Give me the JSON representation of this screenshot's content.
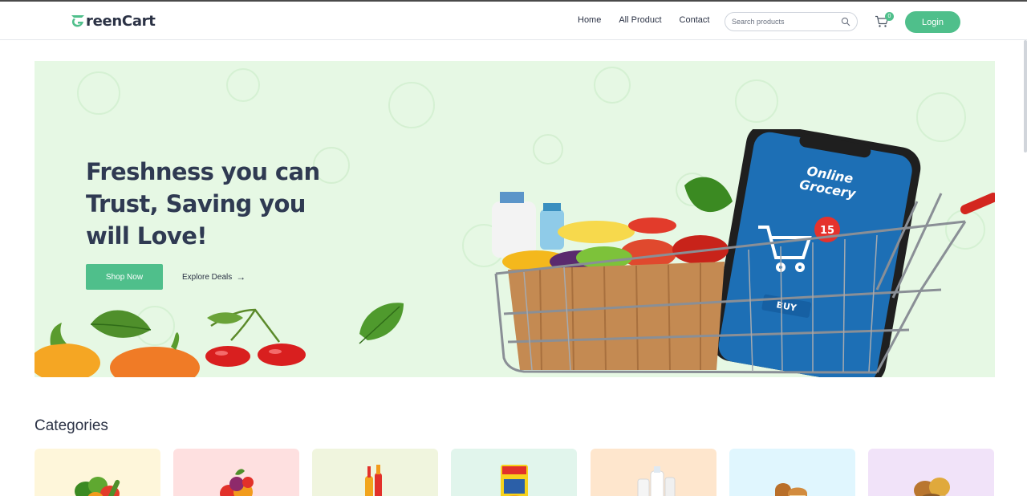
{
  "brand": {
    "name": "reenCart",
    "accent": "#4fbf8b"
  },
  "nav": {
    "links": [
      "Home",
      "All Product",
      "Contact"
    ]
  },
  "search": {
    "placeholder": "Search products",
    "icon": "search-icon"
  },
  "cart": {
    "count": "0",
    "icon": "cart-icon"
  },
  "login": {
    "label": "Login"
  },
  "hero": {
    "title": "Freshness you can Trust, Saving you will Love!",
    "primary_cta": "Shop Now",
    "secondary_cta": "Explore Deals",
    "phone_text_1": "Online",
    "phone_text_2": "Grocery",
    "phone_badge": "15",
    "phone_button": "BUY",
    "background": "#e6f8e4"
  },
  "categories": {
    "title": "Categories",
    "items": [
      {
        "icon": "vegetables-icon",
        "color": "#fef6da"
      },
      {
        "icon": "fruits-icon",
        "color": "#fee0e0"
      },
      {
        "icon": "drinks-icon",
        "color": "#f0f5de"
      },
      {
        "icon": "instant-food-icon",
        "color": "#e1f5ec"
      },
      {
        "icon": "dairy-icon",
        "color": "#fee6cd"
      },
      {
        "icon": "bakery-icon",
        "color": "#e0f6fe"
      },
      {
        "icon": "grains-icon",
        "color": "#f1e3f9"
      }
    ]
  }
}
